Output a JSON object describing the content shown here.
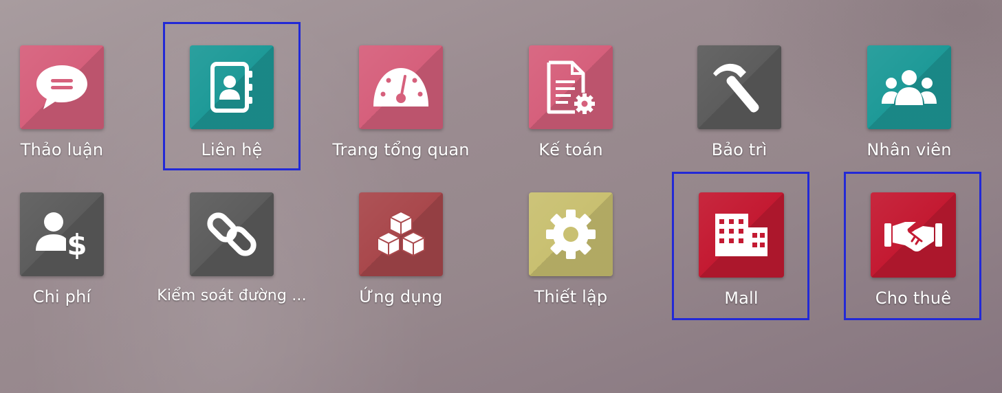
{
  "apps": [
    {
      "label": "Thảo luận",
      "icon": "chat-bubble-icon",
      "color": "#d6607c"
    },
    {
      "label": "Liên hệ",
      "icon": "address-book-icon",
      "color": "#1e9a98"
    },
    {
      "label": "Trang tổng quan",
      "icon": "dashboard-gauge-icon",
      "color": "#d6607c"
    },
    {
      "label": "Kế toán",
      "icon": "invoice-gear-icon",
      "color": "#d6607c"
    },
    {
      "label": "Bảo trì",
      "icon": "hammer-icon",
      "color": "#5d5d5d"
    },
    {
      "label": "Nhân viên",
      "icon": "users-group-icon",
      "color": "#1e9a98"
    },
    {
      "label": "Chi phí",
      "icon": "user-dollar-icon",
      "color": "#5d5d5d"
    },
    {
      "label": "Kiểm soát đường ...",
      "icon": "link-icon",
      "color": "#5d5d5d"
    },
    {
      "label": "Ứng dụng",
      "icon": "cubes-icon",
      "color": "#a9484c"
    },
    {
      "label": "Thiết lập",
      "icon": "gear-icon",
      "color": "#c9c071"
    },
    {
      "label": "Mall",
      "icon": "building-icon",
      "color": "#c41a32"
    },
    {
      "label": "Cho thuê",
      "icon": "handshake-icon",
      "color": "#c41a32"
    }
  ],
  "highlight_color": "#2229d6"
}
